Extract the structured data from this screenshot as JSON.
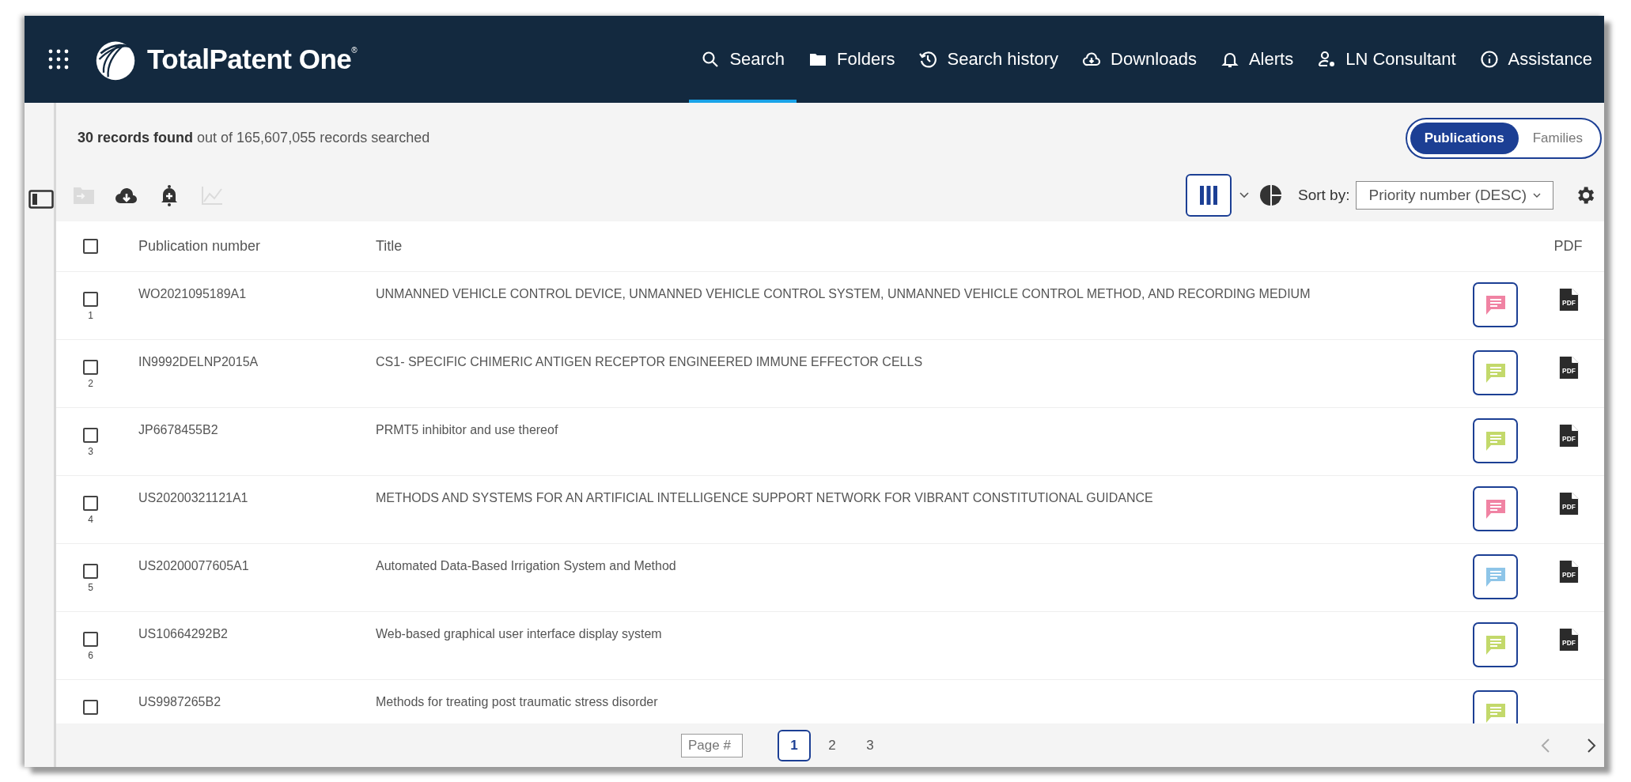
{
  "header": {
    "logo": "TotalPatent One",
    "logo_mark": "®",
    "nav": [
      {
        "kind": "search",
        "label": "Search",
        "selected": true
      },
      {
        "kind": "folder",
        "label": "Folders",
        "selected": false
      },
      {
        "kind": "history",
        "label": "Search history",
        "selected": false
      },
      {
        "kind": "download",
        "label": "Downloads",
        "selected": false
      },
      {
        "kind": "bell",
        "label": "Alerts",
        "selected": false
      },
      {
        "kind": "consultant",
        "label": "LN Consultant",
        "selected": false
      },
      {
        "kind": "info",
        "label": "Assistance",
        "selected": false
      }
    ]
  },
  "summary": {
    "count": "30 records found",
    "rest": "out of 165,607,055 records searched"
  },
  "view_toggle": [
    {
      "label": "Publications",
      "selected": true
    },
    {
      "label": "Families",
      "selected": false
    }
  ],
  "toolbar": [
    {
      "kind": "folder-import",
      "disabled": true
    },
    {
      "kind": "download",
      "disabled": false
    },
    {
      "kind": "alert-add",
      "disabled": false
    },
    {
      "kind": "chart",
      "disabled": true
    }
  ],
  "columns_button": {
    "selected": true
  },
  "sort": {
    "label": "Sort by:",
    "value": "Priority number (DESC)"
  },
  "table": {
    "select_all": {
      "checked": false
    },
    "columns": [
      "Publication number",
      "Title",
      "PDF"
    ],
    "rows": [
      {
        "index": "1",
        "number": "WO2021095189A1",
        "title": "UNMANNED VEHICLE CONTROL DEVICE, UNMANNED VEHICLE CONTROL SYSTEM, UNMANNED VEHICLE CONTROL METHOD, AND RECORDING MEDIUM",
        "checked": false,
        "color": "#f083a3",
        "pdf": "PDF"
      },
      {
        "index": "2",
        "number": "IN9992DELNP2015A",
        "title": "CS1- SPECIFIC CHIMERIC ANTIGEN RECEPTOR ENGINEERED IMMUNE EFFECTOR CELLS",
        "checked": false,
        "color": "#c3d96b",
        "pdf": "PDF"
      },
      {
        "index": "3",
        "number": "JP6678455B2",
        "title": "PRMT5 inhibitor and use thereof",
        "checked": false,
        "color": "#c3d96b",
        "pdf": "PDF"
      },
      {
        "index": "4",
        "number": "US20200321121A1",
        "title": "METHODS AND SYSTEMS FOR AN ARTIFICIAL INTELLIGENCE SUPPORT NETWORK FOR VIBRANT CONSTITUTIONAL GUIDANCE",
        "checked": false,
        "color": "#f083a3",
        "pdf": "PDF"
      },
      {
        "index": "5",
        "number": "US20200077605A1",
        "title": "Automated Data-Based Irrigation System and Method",
        "checked": false,
        "color": "#8ec5e8",
        "pdf": "PDF"
      },
      {
        "index": "6",
        "number": "US10664292B2",
        "title": "Web-based graphical user interface display system",
        "checked": false,
        "color": "#c3d96b",
        "pdf": "PDF"
      },
      {
        "number": "US9987265B2",
        "title": "Methods for treating post traumatic stress disorder",
        "checked": false,
        "color": "#c3d96b"
      }
    ]
  },
  "pagination": {
    "placeholder": "Page #",
    "pages": [
      {
        "label": "1",
        "selected": true
      },
      {
        "label": "2",
        "selected": false
      },
      {
        "label": "3",
        "selected": false
      }
    ]
  }
}
